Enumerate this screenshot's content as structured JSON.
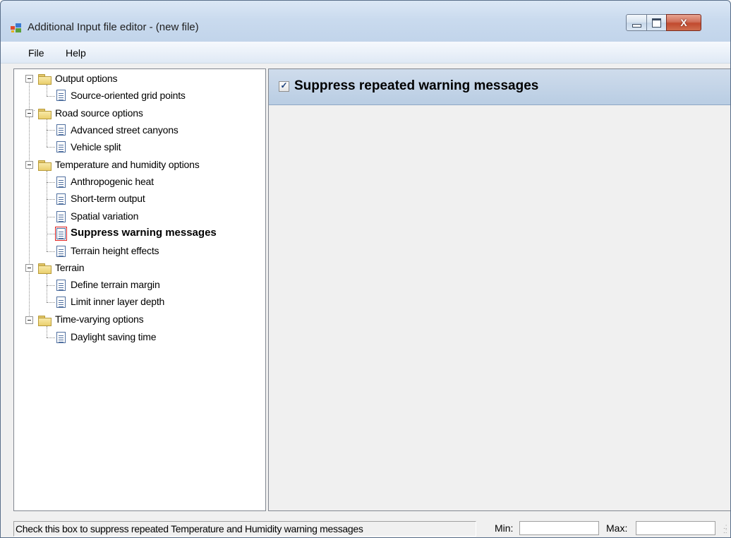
{
  "window": {
    "title": "Additional Input file editor - (new file)",
    "close_glyph": "X"
  },
  "menu": {
    "file_label": "File",
    "help_label": "Help"
  },
  "tree": {
    "groups": [
      {
        "label": "Output options",
        "items": [
          "Source-oriented grid points"
        ]
      },
      {
        "label": "Road source options",
        "items": [
          "Advanced street canyons",
          "Vehicle split"
        ]
      },
      {
        "label": "Temperature and humidity options",
        "items": [
          "Anthropogenic heat",
          "Short-term output",
          "Spatial variation",
          "Suppress warning messages",
          "Terrain height effects"
        ]
      },
      {
        "label": "Terrain",
        "items": [
          "Define terrain margin",
          "Limit inner layer depth"
        ]
      },
      {
        "label": "Time-varying options",
        "items": [
          "Daylight saving time"
        ]
      }
    ],
    "selected_item": "Suppress warning messages"
  },
  "detail": {
    "checkbox_label": "Suppress repeated warning messages",
    "checked": true,
    "tick_glyph": "✓"
  },
  "statusbar": {
    "message": "Check this box to suppress repeated Temperature and Humidity warning messages",
    "min_label": "Min:",
    "min_value": "",
    "max_label": "Max:",
    "max_value": ""
  },
  "colors": {
    "header_gradient_top": "#cfdcec",
    "header_gradient_bottom": "#b9cde3",
    "close_button": "#c14a2f",
    "selection_outline": "#dd2222"
  }
}
